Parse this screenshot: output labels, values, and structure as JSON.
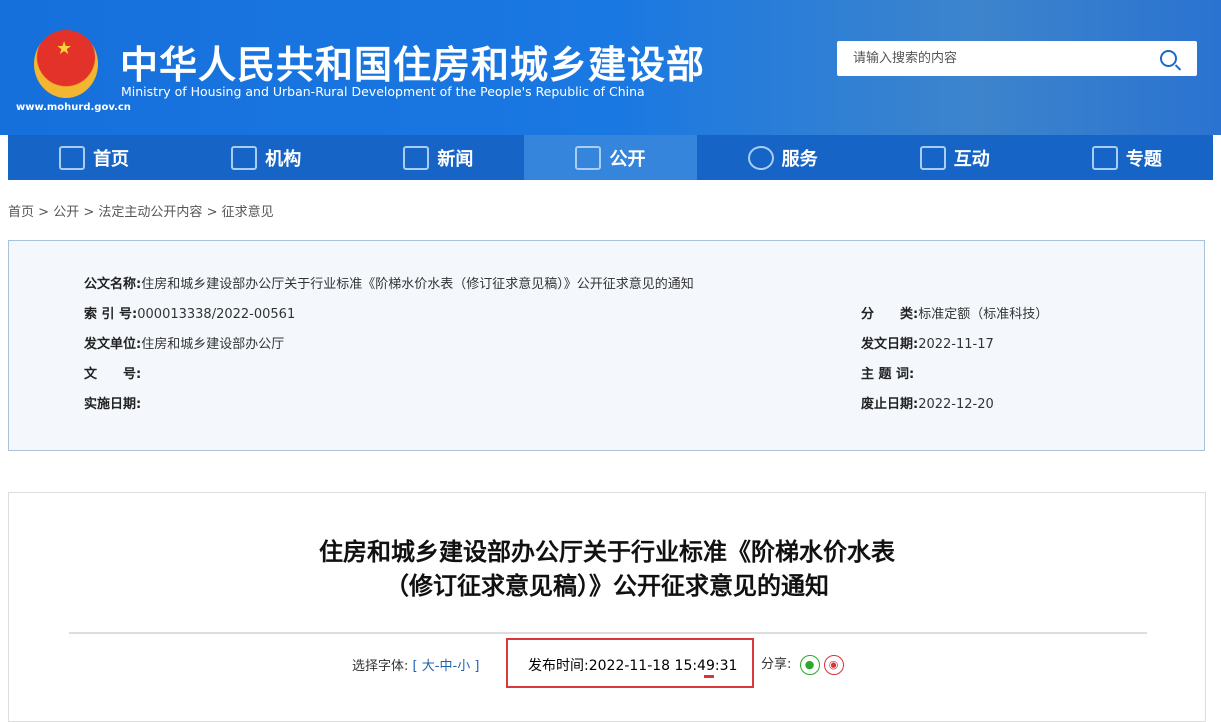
{
  "header": {
    "title": "中华人民共和国住房和城乡建设部",
    "subtitle": "Ministry of Housing and Urban-Rural Development of the People's Republic of China",
    "url": "www.mohurd.gov.cn",
    "search_placeholder": "请输入搜索的内容"
  },
  "nav": [
    {
      "label": "首页",
      "icon": "home-icon"
    },
    {
      "label": "机构",
      "icon": "building-icon"
    },
    {
      "label": "新闻",
      "icon": "news-icon"
    },
    {
      "label": "公开",
      "icon": "document-icon",
      "active": true
    },
    {
      "label": "服务",
      "icon": "service-icon"
    },
    {
      "label": "互动",
      "icon": "interaction-icon"
    },
    {
      "label": "专题",
      "icon": "star-icon"
    }
  ],
  "breadcrumb": [
    "首页",
    "公开",
    "法定主动公开内容",
    "征求意见"
  ],
  "breadcrumb_sep": ">",
  "info": {
    "name_label": "公文名称:",
    "name": "住房和城乡建设部办公厅关于行业标准《阶梯水价水表（修订征求意见稿）》公开征求意见的通知",
    "index_label": "索 引 号:",
    "index": "000013338/2022-00561",
    "category_label": "分　　类:",
    "category": "标准定额（标准科技）",
    "issuer_label": "发文单位:",
    "issuer": "住房和城乡建设部办公厅",
    "issue_date_label": "发文日期:",
    "issue_date": "2022-11-17",
    "doc_no_label": "文　　号:",
    "doc_no": "",
    "keywords_label": "主 题 词:",
    "keywords": "",
    "effective_label": "实施日期:",
    "effective": "",
    "expiry_label": "废止日期:",
    "expiry": "2022-12-20"
  },
  "article": {
    "title_line1": "住房和城乡建设部办公厅关于行业标准《阶梯水价水表",
    "title_line2": "（修订征求意见稿）》公开征求意见的通知",
    "font_label": "选择字体:",
    "font_open": "[",
    "font_large": "大",
    "font_mid": "中",
    "font_small": "小",
    "font_close": "]",
    "dash": "-",
    "publish_label": "发布时间:",
    "publish_time": "2022-11-18 15:49:31",
    "share_label": "分享:"
  },
  "colors": {
    "header": "#1a78e2",
    "nav": "#1664c6",
    "nav_active": "#3685dc",
    "highlight": "#d83a3a"
  }
}
